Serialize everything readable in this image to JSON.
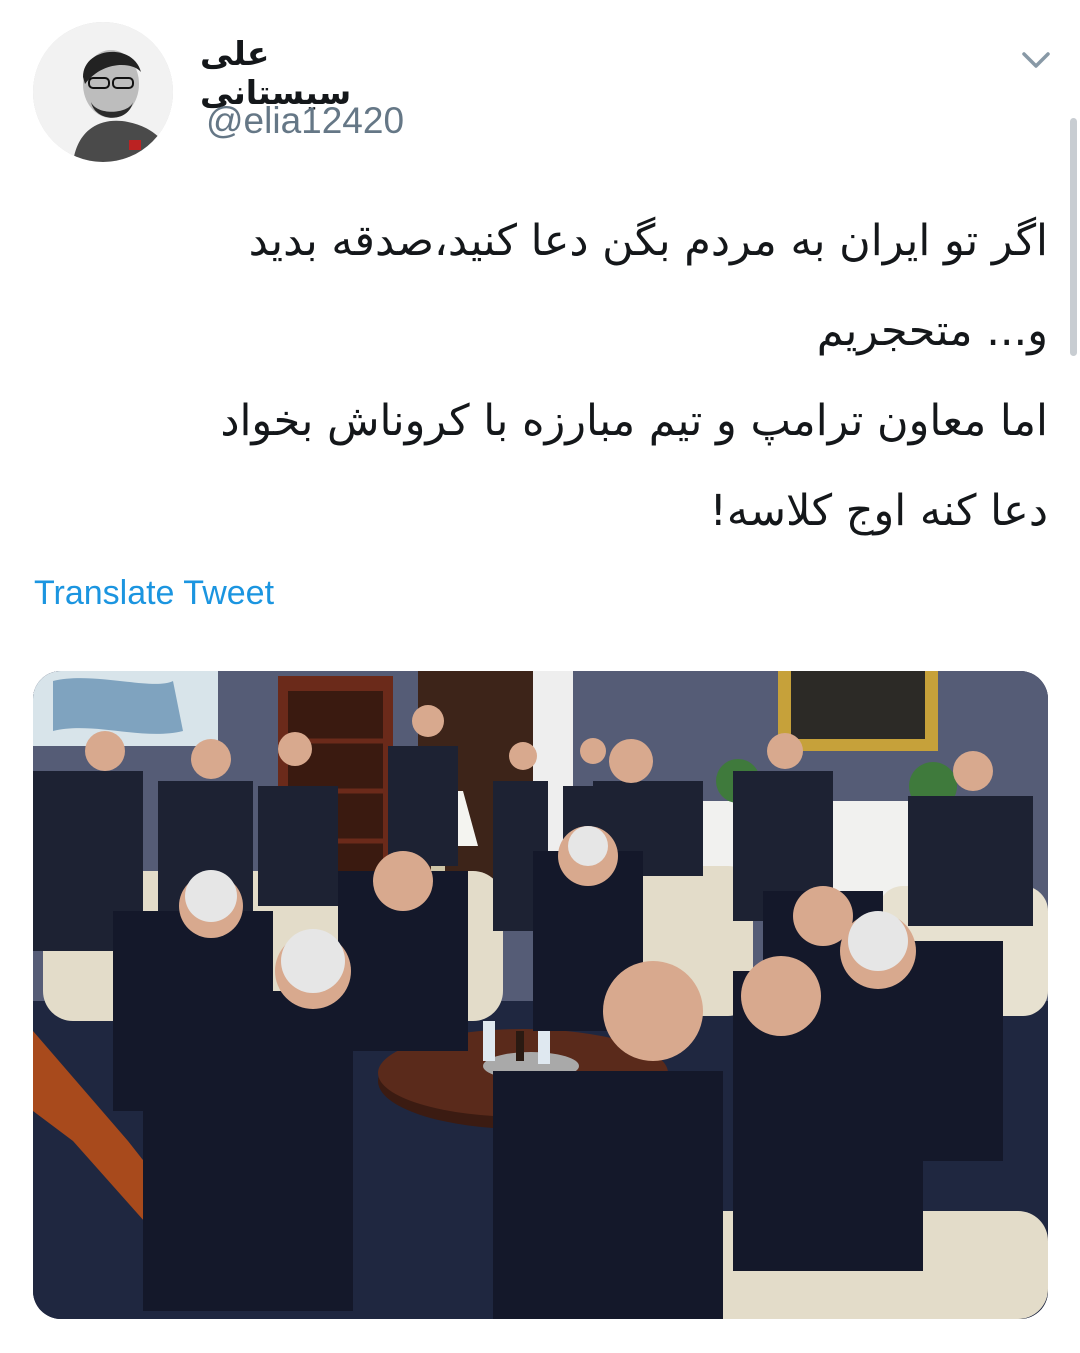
{
  "tweet": {
    "display_name": "علی سیستانی",
    "handle": "@elia12420",
    "text_lines": [
      "اگر تو ایران به مردم بگن دعا کنید،صدقه بدید",
      "و... متحجریم",
      "اما معاون ترامپ و تیم مبارزه با کروناش بخواد",
      "دعا کنه اوج کلاسه!"
    ],
    "translate_label": "Translate Tweet",
    "menu_icon": "chevron-down-icon"
  },
  "colors": {
    "text_primary": "#14171a",
    "text_secondary": "#657786",
    "link": "#1b95e0"
  }
}
